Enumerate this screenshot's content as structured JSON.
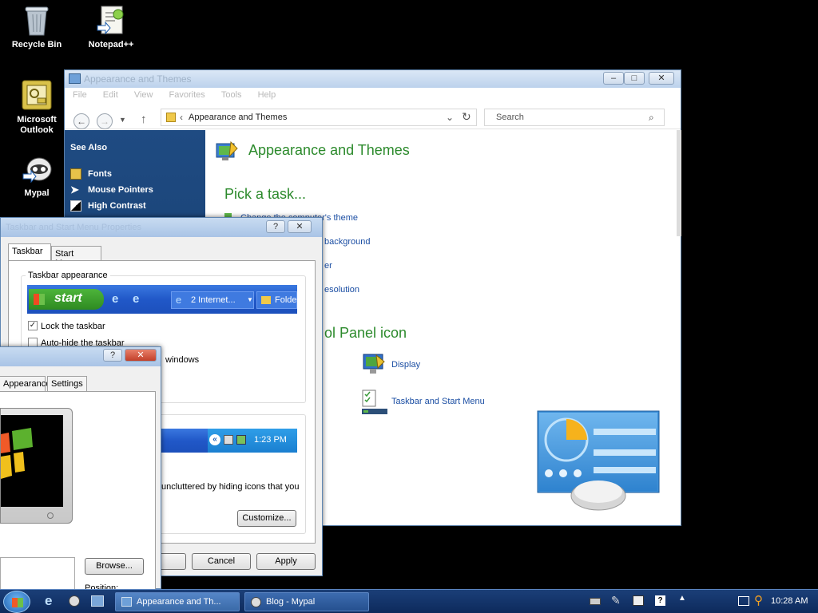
{
  "desktop": {
    "icons": [
      {
        "label": "Recycle Bin",
        "icon": "recycle-bin-icon"
      },
      {
        "label": "Notepad++",
        "icon": "notepad-plus-plus-icon"
      },
      {
        "label": "Microsoft Outlook",
        "icon": "outlook-icon"
      },
      {
        "label": "Mypal",
        "icon": "mypal-browser-icon"
      }
    ]
  },
  "explorer": {
    "title": "Appearance and Themes",
    "menu": [
      "File",
      "Edit",
      "View",
      "Favorites",
      "Tools",
      "Help"
    ],
    "address": "Appearance and Themes",
    "address_chevron": "‹",
    "search_placeholder": "Search",
    "see_also": "See Also",
    "sidebar_items": [
      "Fonts",
      "Mouse Pointers",
      "High Contrast"
    ],
    "heading": "Appearance and Themes",
    "pick_task": "Pick a task...",
    "tasks": [
      "Change the computer's theme",
      "background",
      "er",
      "esolution"
    ],
    "pick_icon": "ol Panel icon",
    "icons": [
      "Display",
      "Taskbar and Start Menu"
    ]
  },
  "taskbar_dialog": {
    "title": "Taskbar and Start Menu Properties",
    "tabs": [
      "Taskbar",
      "Start Menu"
    ],
    "group_appearance": "Taskbar appearance",
    "preview": {
      "start": "start",
      "button1": "2 Internet...",
      "button2": "Folde"
    },
    "options": [
      {
        "label": "Lock the taskbar",
        "checked": true
      },
      {
        "label": "Auto-hide the taskbar",
        "checked": false
      }
    ],
    "partial_windows": "windows",
    "tray_time": "1:23 PM",
    "tray_text": "uncluttered by hiding icons that you",
    "customize": "Customize...",
    "cancel": "Cancel",
    "apply": "Apply"
  },
  "display_dialog": {
    "tabs": [
      "Appearance",
      "Settings"
    ],
    "browse": "Browse...",
    "position": "Position:"
  },
  "taskbar": {
    "buttons": [
      "Appearance and Th...",
      "Blog - Mypal"
    ],
    "clock": "10:28 AM"
  },
  "colors": {
    "accent_green": "#2c8a2c",
    "link_blue": "#1b4ea3",
    "sidebar": "#1a4478"
  }
}
